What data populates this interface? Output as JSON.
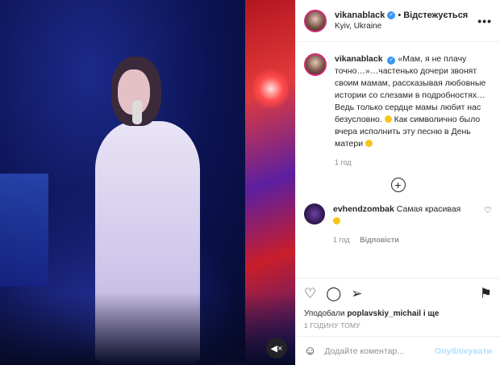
{
  "post": {
    "username": "vikanablack",
    "follow_label": "Відстежується",
    "location": "Kyiv, Ukraine",
    "more_icon": "more-icon"
  },
  "caption": {
    "username": "vikanablack",
    "text_main": "«Мам, я не плачу точно…»…частенько дочери звонят своим мамам, рассказывая любовные истории со слезами в подробностях… Ведь только сердце мамы любит нас безусловно.",
    "text_end": "Как символично было вчера исполнить эту песню в День матери",
    "time": "1 год"
  },
  "more_comments_icon": "plus-circle-icon",
  "comment": {
    "username": "evhendzombak",
    "text": "Самая красивая",
    "time": "1 год",
    "reply_label": "Відповісти"
  },
  "likes": {
    "prefix": "Уподобали",
    "user": "poplavskiy_michail",
    "suffix": "і ще"
  },
  "post_time": "1 годину тому",
  "composer": {
    "placeholder": "Додайте коментар...",
    "publish_label": "Опублікувати"
  },
  "colors": {
    "verified": "#3897f0",
    "publish_disabled": "#b2dffc",
    "story_ring": "#d62976"
  }
}
